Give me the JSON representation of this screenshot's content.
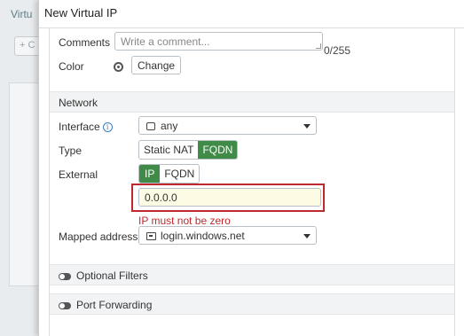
{
  "background": {
    "tab_label": "Virtu",
    "button_label": "+ C"
  },
  "dialog": {
    "title": "New Virtual IP"
  },
  "form": {
    "comments": {
      "label": "Comments",
      "placeholder": "Write a comment...",
      "count": "0/255"
    },
    "color": {
      "label": "Color",
      "button": "Change"
    },
    "network": {
      "section_title": "Network",
      "interface": {
        "label": "Interface",
        "value": "any"
      },
      "type": {
        "label": "Type",
        "options": [
          "Static NAT",
          "FQDN"
        ],
        "selected": "FQDN"
      },
      "external": {
        "label": "External",
        "options": [
          "IP",
          "FQDN"
        ],
        "selected": "IP"
      },
      "ip_value": "0.0.0.0",
      "error": "IP must not be zero",
      "mapped_address": {
        "label": "Mapped address",
        "value": "login.windows.net"
      }
    },
    "optional_filters": {
      "label": "Optional Filters"
    },
    "port_forwarding": {
      "label": "Port Forwarding"
    }
  },
  "colors": {
    "accent_green": "#3f8b47",
    "error_red": "#c0282d",
    "info_blue": "#3b7dc4"
  }
}
